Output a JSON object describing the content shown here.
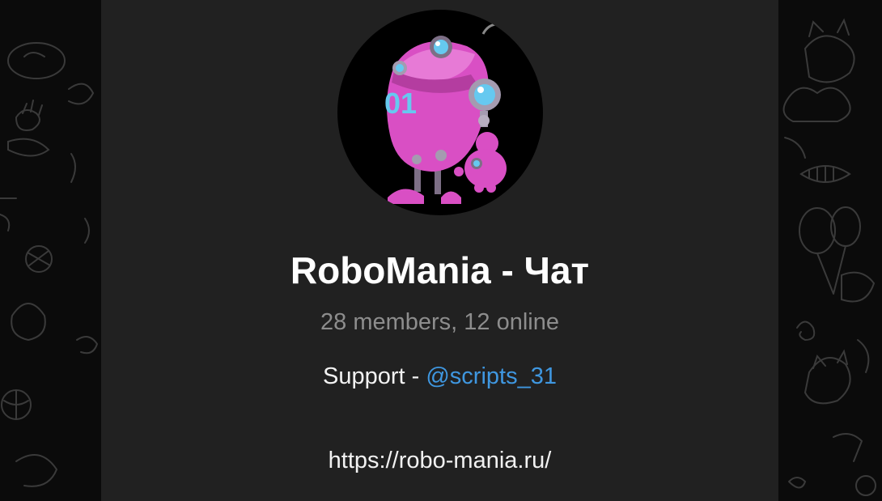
{
  "chat": {
    "title": "RoboMania - Чат",
    "subtitle": "28 members, 12 online",
    "description": {
      "support_prefix": "Support - ",
      "support_mention": "@scripts_31",
      "website": "https://robo-mania.ru/"
    },
    "avatar_icon": "robot-avatar-icon",
    "avatar_number": "01"
  },
  "colors": {
    "panel_bg": "#212121",
    "page_bg": "#0b0b0b",
    "title": "#ffffff",
    "subtitle": "#8d8d8d",
    "mention": "#3f97e0",
    "robot_body": "#d94fc4"
  }
}
